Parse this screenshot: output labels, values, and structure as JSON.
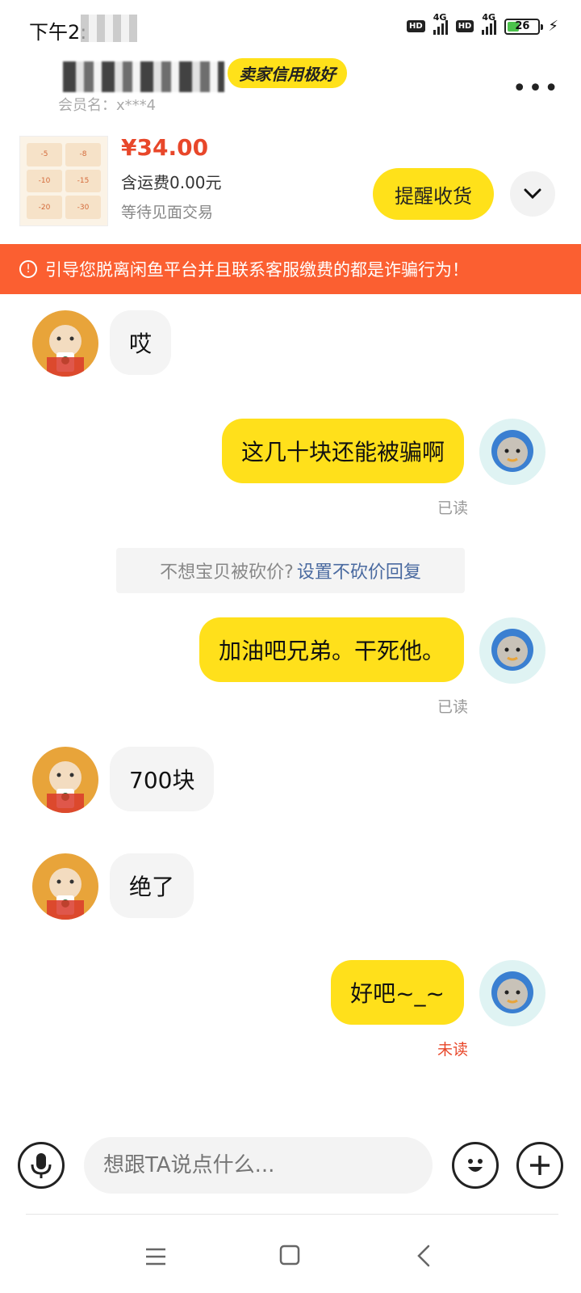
{
  "status_bar": {
    "time": "下午2:",
    "network1": "4G",
    "network2": "4G",
    "hd": "HD",
    "battery": "26"
  },
  "header": {
    "badge": "卖家信用极好",
    "member": "会员名：x***4",
    "more_icon": "more-dots-icon"
  },
  "product": {
    "price": "¥34.00",
    "shipping": "含运费0.00元",
    "status": "等待见面交易",
    "remind_button": "提醒收货",
    "thumb_tags": [
      "-5",
      "-8",
      "-10",
      "-15",
      "-20",
      "-30"
    ]
  },
  "warning": {
    "text": "引导您脱离闲鱼平台并且联系客服缴费的都是诈骗行为！"
  },
  "messages": [
    {
      "side": "left",
      "text": "哎"
    },
    {
      "side": "right",
      "text": "这几十块还能被骗啊",
      "status": "已读"
    },
    {
      "side": "right",
      "text": "加油吧兄弟。干死他。",
      "status": "已读"
    },
    {
      "side": "left",
      "text": "700块"
    },
    {
      "side": "left",
      "text": "绝了"
    },
    {
      "side": "right",
      "text": "好吧~_~",
      "status": "未读"
    }
  ],
  "system_tip": {
    "text": "不想宝贝被砍价?",
    "link": "设置不砍价回复"
  },
  "input": {
    "placeholder": "想跟TA说点什么..."
  },
  "colors": {
    "accent": "#ffe01b",
    "warning": "#fb5f31",
    "price": "#e8472a"
  }
}
